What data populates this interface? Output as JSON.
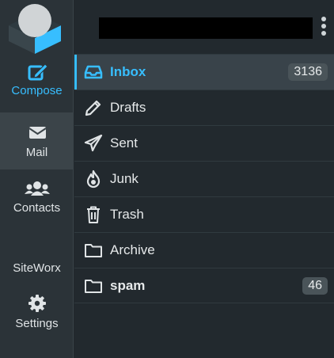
{
  "nav": {
    "compose": "Compose",
    "mail": "Mail",
    "contacts": "Contacts",
    "siteworx": "SiteWorx",
    "settings": "Settings"
  },
  "folders": [
    {
      "name": "Inbox",
      "count": "3136",
      "icon": "inbox-icon"
    },
    {
      "name": "Drafts",
      "count": "",
      "icon": "pencil-icon"
    },
    {
      "name": "Sent",
      "count": "",
      "icon": "paper-plane-icon"
    },
    {
      "name": "Junk",
      "count": "",
      "icon": "fire-icon"
    },
    {
      "name": "Trash",
      "count": "",
      "icon": "trash-icon"
    },
    {
      "name": "Archive",
      "count": "",
      "icon": "folder-icon"
    },
    {
      "name": "spam",
      "count": "46",
      "icon": "folder-icon"
    }
  ],
  "colors": {
    "accent": "#37beff",
    "rail_bg": "#2b3338",
    "pane_bg": "#22292e",
    "selected_bg": "#39434a"
  }
}
